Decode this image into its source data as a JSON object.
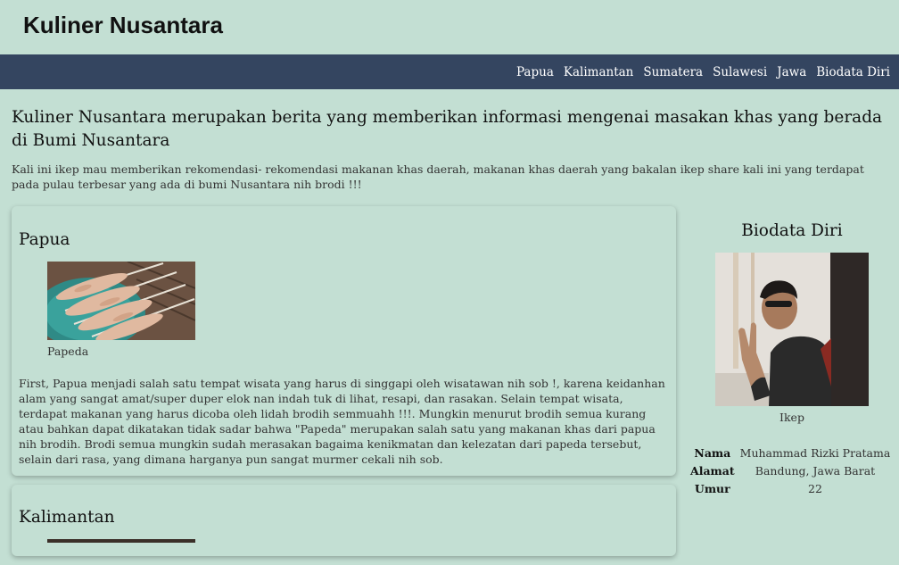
{
  "site": {
    "title": "Kuliner Nusantara"
  },
  "nav": [
    "Papua",
    "Kalimantan",
    "Sumatera",
    "Sulawesi",
    "Jawa",
    "Biodata Diri"
  ],
  "intro": {
    "heading": "Kuliner Nusantara merupakan berita yang memberikan informasi mengenai masakan khas yang berada di Bumi Nusantara",
    "text": "Kali ini ikep mau memberikan rekomendasi- rekomendasi makanan khas daerah, makanan khas daerah yang bakalan ikep share kali ini yang terdapat pada pulau terbesar yang ada di bumi Nusantara nih brodi !!!"
  },
  "articles": [
    {
      "title": "Papua",
      "caption": "Papeda",
      "body": "First, Papua menjadi salah satu tempat wisata yang harus di singgapi oleh wisatawan nih sob !, karena keidanhan alam yang sangat amat/super duper elok nan indah tuk di lihat, resapi, dan rasakan. Selain tempat wisata, terdapat makanan yang harus dicoba oleh lidah brodih semmuahh !!!. Mungkin menurut brodih semua kurang atau bahkan dapat dikatakan tidak sadar bahwa \"Papeda\" merupakan salah satu yang makanan khas dari papua nih brodih. Brodi semua mungkin sudah merasakan bagaima kenikmatan dan kelezatan dari papeda tersebut, selain dari rasa, yang dimana harganya pun sangat murmer cekali nih sob."
    },
    {
      "title": "Kalimantan"
    }
  ],
  "bio": {
    "title": "Biodata Diri",
    "caption": "Ikep",
    "rows": [
      {
        "key": "Nama",
        "value": "Muhammad Rizki Pratama"
      },
      {
        "key": "Alamat",
        "value": "Bandung, Jawa Barat"
      },
      {
        "key": "Umur",
        "value": "22"
      }
    ]
  }
}
